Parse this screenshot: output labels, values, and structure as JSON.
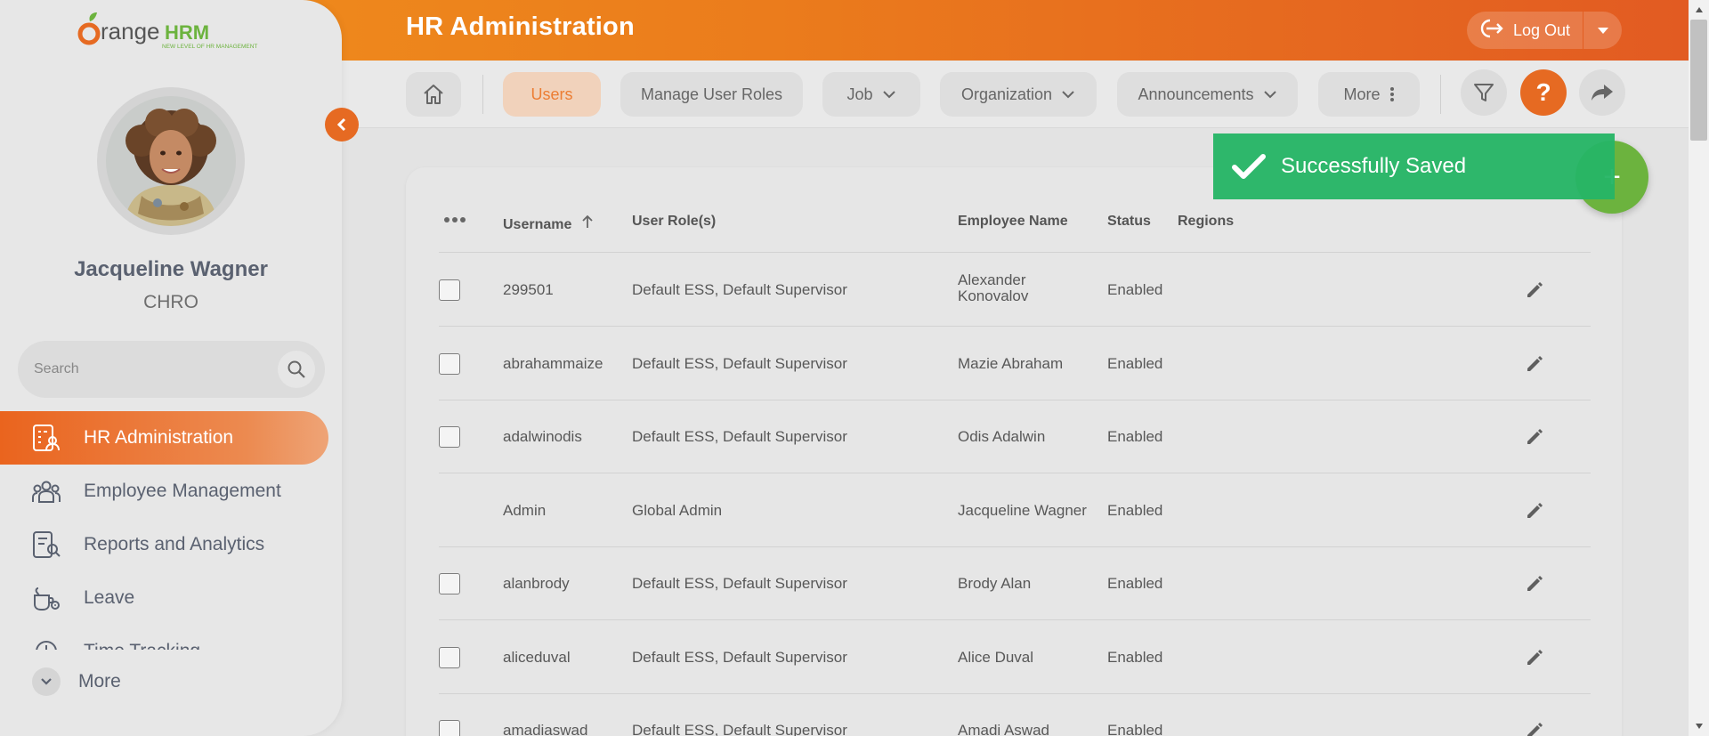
{
  "header": {
    "title": "HR Administration",
    "logout_label": "Log Out"
  },
  "brand": {
    "logo_text": "orangeHRM",
    "logo_prefix": "orange",
    "logo_suffix": "HRM",
    "tagline": "NEW LEVEL OF HR MANAGEMENT"
  },
  "user": {
    "name": "Jacqueline Wagner",
    "role": "CHRO"
  },
  "search": {
    "placeholder": "Search"
  },
  "sidebar": {
    "items": [
      {
        "label": "HR Administration",
        "icon": "hr-admin-icon",
        "active": true
      },
      {
        "label": "Employee Management",
        "icon": "employees-icon",
        "active": false
      },
      {
        "label": "Reports and Analytics",
        "icon": "reports-icon",
        "active": false
      },
      {
        "label": "Leave",
        "icon": "leave-icon",
        "active": false
      },
      {
        "label": "Time Tracking",
        "icon": "clock-icon",
        "active": false
      }
    ],
    "more_label": "More"
  },
  "subnav": {
    "tabs": [
      {
        "label": "Users",
        "active": true
      },
      {
        "label": "Manage User Roles"
      },
      {
        "label": "Job",
        "dropdown": true
      },
      {
        "label": "Organization",
        "dropdown": true
      },
      {
        "label": "Announcements",
        "dropdown": true
      },
      {
        "label": "More",
        "kebab": true
      }
    ]
  },
  "toast": {
    "message": "Successfully Saved"
  },
  "fab": {
    "symbol": "+"
  },
  "table": {
    "columns": [
      "Username",
      "User Role(s)",
      "Employee Name",
      "Status",
      "Regions"
    ],
    "rows": [
      {
        "username": "299501",
        "roles": "Default ESS, Default Supervisor",
        "employee_line1": "Alexander",
        "employee_line2": "Konovalov",
        "status": "Enabled",
        "checkbox": true
      },
      {
        "username": "abrahammaize",
        "roles": "Default ESS, Default Supervisor",
        "employee_line1": "Mazie Abraham",
        "employee_line2": "",
        "status": "Enabled",
        "checkbox": true
      },
      {
        "username": "adalwinodis",
        "roles": "Default ESS, Default Supervisor",
        "employee_line1": "Odis Adalwin",
        "employee_line2": "",
        "status": "Enabled",
        "checkbox": true
      },
      {
        "username": "Admin",
        "roles": "Global Admin",
        "employee_line1": "Jacqueline Wagner",
        "employee_line2": "",
        "status": "Enabled",
        "checkbox": false
      },
      {
        "username": "alanbrody",
        "roles": "Default ESS, Default Supervisor",
        "employee_line1": "Brody Alan",
        "employee_line2": "",
        "status": "Enabled",
        "checkbox": true
      },
      {
        "username": "aliceduval",
        "roles": "Default ESS, Default Supervisor",
        "employee_line1": "Alice Duval",
        "employee_line2": "",
        "status": "Enabled",
        "checkbox": true
      },
      {
        "username": "amadiaswad",
        "roles": "Default ESS, Default Supervisor",
        "employee_line1": "Amadi Aswad",
        "employee_line2": "",
        "status": "Enabled",
        "checkbox": true
      }
    ]
  },
  "colors": {
    "accent": "#E66A22",
    "header_start": "#F0901C",
    "header_end": "#E25A22",
    "toast": "#26B566",
    "fab": "#6CB33E",
    "help": "#E66A22"
  }
}
